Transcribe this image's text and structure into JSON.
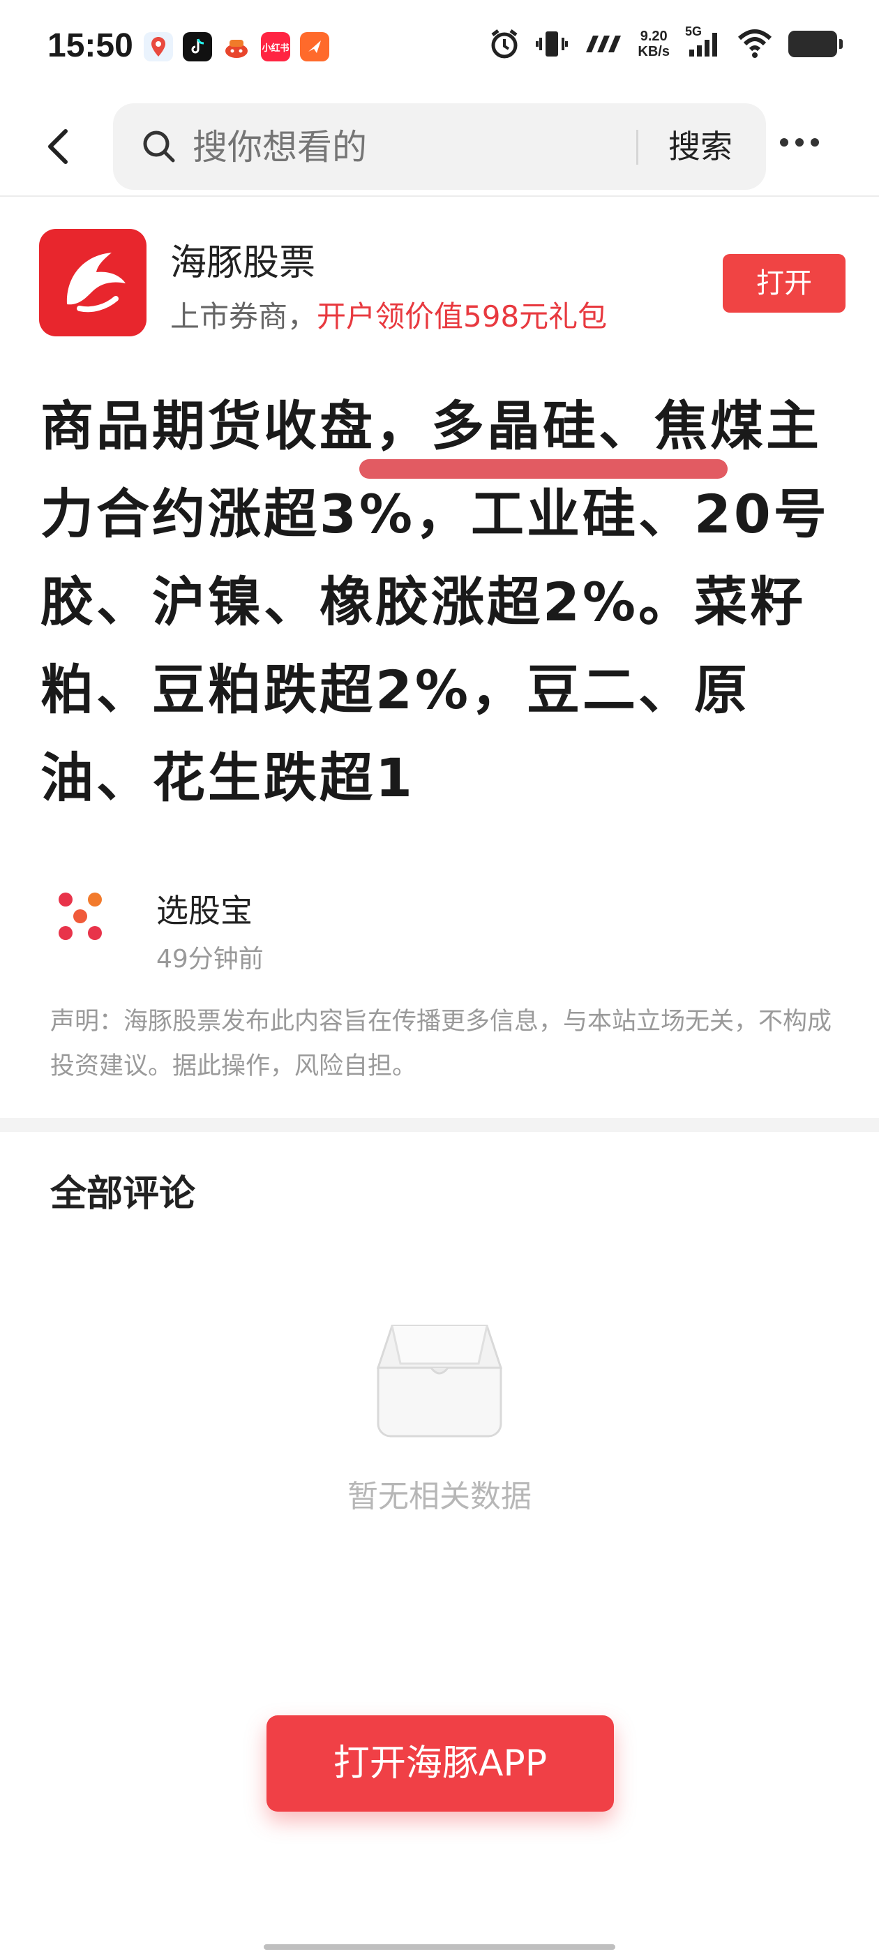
{
  "status_bar": {
    "time": "15:50",
    "network_speed_value": "9.20",
    "network_speed_unit": "KB/s",
    "network_type": "5G",
    "app_icons": [
      {
        "name": "baidu-map-icon",
        "color": "#4a90e2"
      },
      {
        "name": "douyin-icon",
        "color": "#111111"
      },
      {
        "name": "taobao-icon",
        "color": "#ff6a00"
      },
      {
        "name": "xiaohongshu-icon",
        "color": "#ff2442",
        "label": "小红书"
      },
      {
        "name": "feather-app-icon",
        "color": "#ff6a2b"
      }
    ]
  },
  "header": {
    "search_placeholder": "搜你想看的",
    "search_button": "搜索"
  },
  "promo": {
    "app_name": "海豚股票",
    "desc_prefix": "上市券商，",
    "desc_highlight": "开户领价值598元礼包",
    "open_button": "打开",
    "accent_color": "#f04444"
  },
  "article": {
    "title": "商品期货收盘，多晶硅、焦煤主力合约涨超3%，工业硅、20号胶、沪镍、橡胶涨超2%。菜籽粕、豆粕跌超2%，豆二、原油、花生跌超1",
    "author_name": "选股宝",
    "time_ago": "49分钟前",
    "disclaimer": "声明：海豚股票发布此内容旨在传播更多信息，与本站立场无关，不构成投资建议。据此操作，风险自担。"
  },
  "comments": {
    "title": "全部评论",
    "empty_text": "暂无相关数据"
  },
  "cta": {
    "label": "打开海豚APP",
    "color": "#f04046"
  }
}
